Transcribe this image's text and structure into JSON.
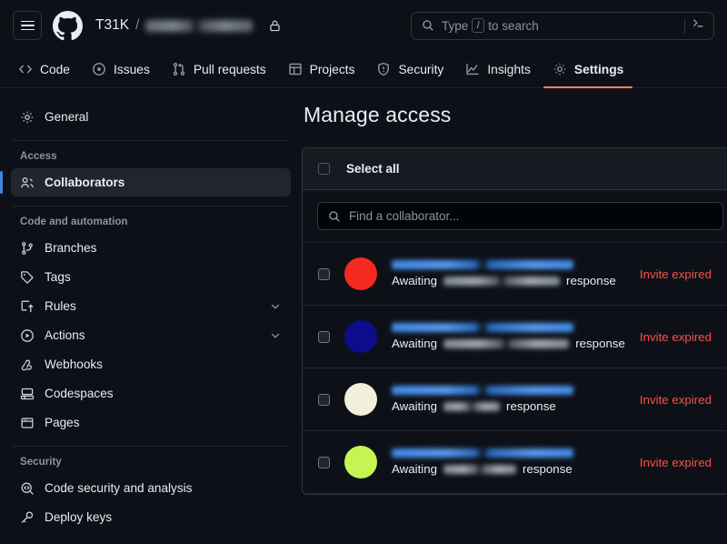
{
  "header": {
    "menu_icon": "hamburger-icon",
    "logo_icon": "github-logo-icon",
    "owner": "T31K",
    "separator": "/",
    "repo_name_redacted": "",
    "visibility_icon": "lock-icon",
    "search": {
      "icon": "search-icon",
      "placeholder_prefix": "Type",
      "placeholder_key": "/",
      "placeholder_suffix": "to search",
      "command_icon": "terminal-icon"
    }
  },
  "nav": {
    "tabs": [
      {
        "label": "Code",
        "icon": "code-icon",
        "active": false
      },
      {
        "label": "Issues",
        "icon": "issue-opened-icon",
        "active": false
      },
      {
        "label": "Pull requests",
        "icon": "git-pull-request-icon",
        "active": false
      },
      {
        "label": "Projects",
        "icon": "table-icon",
        "active": false
      },
      {
        "label": "Security",
        "icon": "shield-icon",
        "active": false
      },
      {
        "label": "Insights",
        "icon": "graph-icon",
        "active": false
      },
      {
        "label": "Settings",
        "icon": "gear-icon",
        "active": true
      }
    ],
    "active_underline_color": "#f78166"
  },
  "sidebar": {
    "general": {
      "label": "General",
      "icon": "gear-icon"
    },
    "groups": [
      {
        "title": "Access",
        "items": [
          {
            "label": "Collaborators",
            "icon": "people-icon",
            "selected": true,
            "expandable": false
          }
        ]
      },
      {
        "title": "Code and automation",
        "items": [
          {
            "label": "Branches",
            "icon": "git-branch-icon",
            "selected": false,
            "expandable": false
          },
          {
            "label": "Tags",
            "icon": "tag-icon",
            "selected": false,
            "expandable": false
          },
          {
            "label": "Rules",
            "icon": "rules-icon",
            "selected": false,
            "expandable": true
          },
          {
            "label": "Actions",
            "icon": "play-icon",
            "selected": false,
            "expandable": true
          },
          {
            "label": "Webhooks",
            "icon": "webhook-icon",
            "selected": false,
            "expandable": false
          },
          {
            "label": "Codespaces",
            "icon": "codespaces-icon",
            "selected": false,
            "expandable": false
          },
          {
            "label": "Pages",
            "icon": "browser-icon",
            "selected": false,
            "expandable": false
          }
        ]
      },
      {
        "title": "Security",
        "items": [
          {
            "label": "Code security and analysis",
            "icon": "codescan-icon",
            "selected": false,
            "expandable": false
          },
          {
            "label": "Deploy keys",
            "icon": "key-icon",
            "selected": false,
            "expandable": false
          }
        ]
      }
    ],
    "selected_indicator_color": "#4184e4"
  },
  "main": {
    "title": "Manage access",
    "select_all_label": "Select all",
    "search": {
      "icon": "search-icon",
      "placeholder": "Find a collaborator..."
    },
    "awaiting_prefix": "Awaiting",
    "awaiting_suffix": "response",
    "status_color": "#f85149",
    "collaborators": [
      {
        "avatar_color": "#f52a1e",
        "name_redacted_width": 200,
        "awaiting_redacted_width": 128,
        "status": "Invite expired"
      },
      {
        "avatar_color": "#0d0d8c",
        "name_redacted_width": 200,
        "awaiting_redacted_width": 152,
        "status": "Invite expired"
      },
      {
        "avatar_color": "#f2f0dc",
        "name_redacted_width": 200,
        "awaiting_redacted_width": 62,
        "status": "Invite expired"
      },
      {
        "avatar_color": "#c4f553",
        "name_redacted_width": 200,
        "awaiting_redacted_width": 80,
        "status": "Invite expired"
      }
    ]
  }
}
